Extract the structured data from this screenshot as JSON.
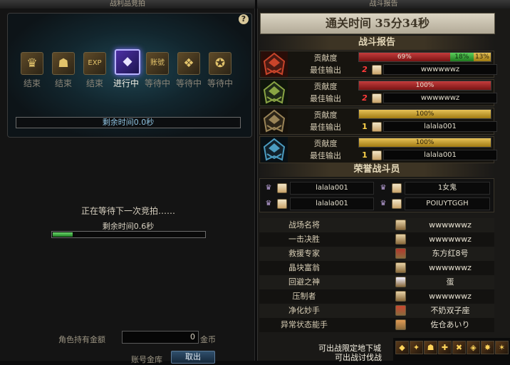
{
  "left": {
    "title": "战利品竞拍",
    "help": "?",
    "lots": [
      {
        "label": "结束",
        "icon": "treasure-chest-icon",
        "glyph": "♛",
        "state": "done"
      },
      {
        "label": "结束",
        "icon": "gold-armor-icon",
        "glyph": "☗",
        "state": "done"
      },
      {
        "label": "结束",
        "icon": "exp-scroll-icon",
        "glyph": "EXP",
        "state": "done"
      },
      {
        "label": "进行中",
        "icon": "purple-crystal-icon",
        "glyph": "◆",
        "state": "active"
      },
      {
        "label": "等待中",
        "icon": "account-chest-icon",
        "glyph": "账號",
        "state": "waiting"
      },
      {
        "label": "等待中",
        "icon": "gold-reward-icon",
        "glyph": "❖",
        "state": "waiting"
      },
      {
        "label": "等待中",
        "icon": "gold-coin-bag-icon",
        "glyph": "✪",
        "state": "waiting"
      }
    ],
    "remaining_time": "剩余时间0.0秒",
    "waiting_text": "正在等待下一次竞拍……",
    "waiting_remaining": "剩余时间0.6秒",
    "progress_fraction": 0.13,
    "gold_label": "角色持有金额",
    "gold_value": "0",
    "gold_unit": "金币",
    "account_label": "账号金库",
    "bid_button": "取出"
  },
  "right": {
    "title": "战斗报告",
    "clear_time": "通关时间   35分34秒",
    "report_header": "战斗报告",
    "contrib_label": "贡献度",
    "best_label": "最佳输出",
    "rows": [
      {
        "avatar": "red-fire-helmet-avatar",
        "colors": [
          "#4a1a12",
          "#c8442a",
          "#2a0d08"
        ],
        "segments": [
          {
            "value": 69,
            "text": "69%",
            "color": "red"
          },
          {
            "value": 18,
            "text": "18%",
            "color": "green"
          },
          {
            "value": 13,
            "text": "13%",
            "color": "gold"
          }
        ],
        "rank": "2",
        "best_player": "wwwwwwz"
      },
      {
        "avatar": "green-dragon-helmet-avatar",
        "colors": [
          "#1f2a17",
          "#8aa544",
          "#0f150b"
        ],
        "segments": [
          {
            "value": 100,
            "text": "100%",
            "color": "red"
          }
        ],
        "rank": "2",
        "best_player": "wwwwwwz"
      },
      {
        "avatar": "bronze-knight-helmet-avatar",
        "colors": [
          "#2b2418",
          "#9a8457",
          "#15110b"
        ],
        "segments": [
          {
            "value": 100,
            "text": "100%",
            "color": "gold"
          }
        ],
        "rank": "1",
        "best_player": "lalala001"
      },
      {
        "avatar": "blue-crystal-helmet-avatar",
        "colors": [
          "#11202a",
          "#4c9cc0",
          "#081015"
        ],
        "segments": [
          {
            "value": 100,
            "text": "100%",
            "color": "gold"
          }
        ],
        "rank": "1",
        "best_player": "lalala001"
      }
    ],
    "honor_header": "荣誉战斗员",
    "honor": [
      {
        "name": "lalala001"
      },
      {
        "name": "1女鬼"
      },
      {
        "name": "lalala001"
      },
      {
        "name": "POIUYTGGH"
      }
    ],
    "titles": [
      {
        "title": "战场名将",
        "player": "wwwwwwz",
        "face": "#e7d2a6"
      },
      {
        "title": "一击决胜",
        "player": "wwwwwwz",
        "face": "#e7d2a6"
      },
      {
        "title": "救援专家",
        "player": "东方红8号",
        "face": "#b3372c"
      },
      {
        "title": "晶块富翁",
        "player": "wwwwwwz",
        "face": "#e7d2a6"
      },
      {
        "title": "回避之神",
        "player": "蛋",
        "face": "#f0f0ff"
      },
      {
        "title": "压制者",
        "player": "wwwwwwz",
        "face": "#e7d2a6"
      },
      {
        "title": "净化妙手",
        "player": "不奶双子座",
        "face": "#c9462f"
      },
      {
        "title": "异常状态能手",
        "player": "佐仓あいり",
        "face": "#e09a54"
      }
    ]
  },
  "notices": [
    "可出战限定地下城",
    "可出战讨伐战"
  ],
  "hotbar": [
    "◆",
    "✦",
    "☗",
    "✚",
    "✖",
    "◈",
    "✸",
    "✶"
  ]
}
